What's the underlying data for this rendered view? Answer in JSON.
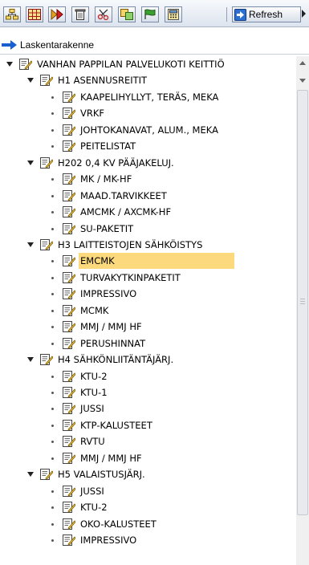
{
  "toolbar": {
    "buttons": [
      {
        "icon": "structure-icon"
      },
      {
        "icon": "grid-icon"
      },
      {
        "icon": "forward-icon"
      },
      {
        "icon": "trash-icon"
      },
      {
        "icon": "cut-icon"
      },
      {
        "icon": "copy-icon"
      },
      {
        "icon": "flag-icon"
      },
      {
        "icon": "calculator-icon"
      }
    ],
    "refresh_label": "Refresh"
  },
  "header": {
    "label": "Laskentarakenne"
  },
  "tree": [
    {
      "label": "VANHAN PAPPILAN PALVELUKOTI KEITTIÖ",
      "level": 0,
      "expanded": true
    },
    {
      "label": "H1 ASENNUSREITIT",
      "level": 1,
      "expanded": true
    },
    {
      "label": "KAAPELIHYLLYT, TERÄS, MEKA",
      "level": 2
    },
    {
      "label": "VRKF",
      "level": 2
    },
    {
      "label": "JOHTOKANAVAT, ALUM., MEKA",
      "level": 2
    },
    {
      "label": "PEITELISTAT",
      "level": 2
    },
    {
      "label": "H202 0,4 KV PÄÄJAKELUJ.",
      "level": 1,
      "expanded": true
    },
    {
      "label": "MK / MK-HF",
      "level": 2
    },
    {
      "label": "MAAD.TARVIKKEET",
      "level": 2
    },
    {
      "label": "AMCMK / AXCMK-HF",
      "level": 2
    },
    {
      "label": "SU-PAKETIT",
      "level": 2
    },
    {
      "label": "H3 LAITTEISTOJEN SÄHKÖISTYS",
      "level": 1,
      "expanded": true
    },
    {
      "label": "EMCMK",
      "level": 2,
      "selected": true
    },
    {
      "label": "TURVAKYTKINPAKETIT",
      "level": 2
    },
    {
      "label": "IMPRESSIVO",
      "level": 2
    },
    {
      "label": "MCMK",
      "level": 2
    },
    {
      "label": "MMJ / MMJ HF",
      "level": 2
    },
    {
      "label": "PERUSHINNAT",
      "level": 2
    },
    {
      "label": "H4 SÄHKÖNLIITÄNTÄJÄRJ.",
      "level": 1,
      "expanded": true
    },
    {
      "label": "KTU-2",
      "level": 2
    },
    {
      "label": "KTU-1",
      "level": 2
    },
    {
      "label": "JUSSI",
      "level": 2
    },
    {
      "label": "KTP-KALUSTEET",
      "level": 2
    },
    {
      "label": "RVTU",
      "level": 2
    },
    {
      "label": "MMJ / MMJ HF",
      "level": 2
    },
    {
      "label": "H5 VALAISTUSJÄRJ.",
      "level": 1,
      "expanded": true
    },
    {
      "label": "JUSSI",
      "level": 2
    },
    {
      "label": "KTU-2",
      "level": 2
    },
    {
      "label": "OKO-KALUSTEET",
      "level": 2
    },
    {
      "label": "IMPRESSIVO",
      "level": 2
    }
  ],
  "colors": {
    "selection": "#fbd97c",
    "arrow": "#1a5fd0",
    "icon_yellow": "#f2c94c"
  }
}
